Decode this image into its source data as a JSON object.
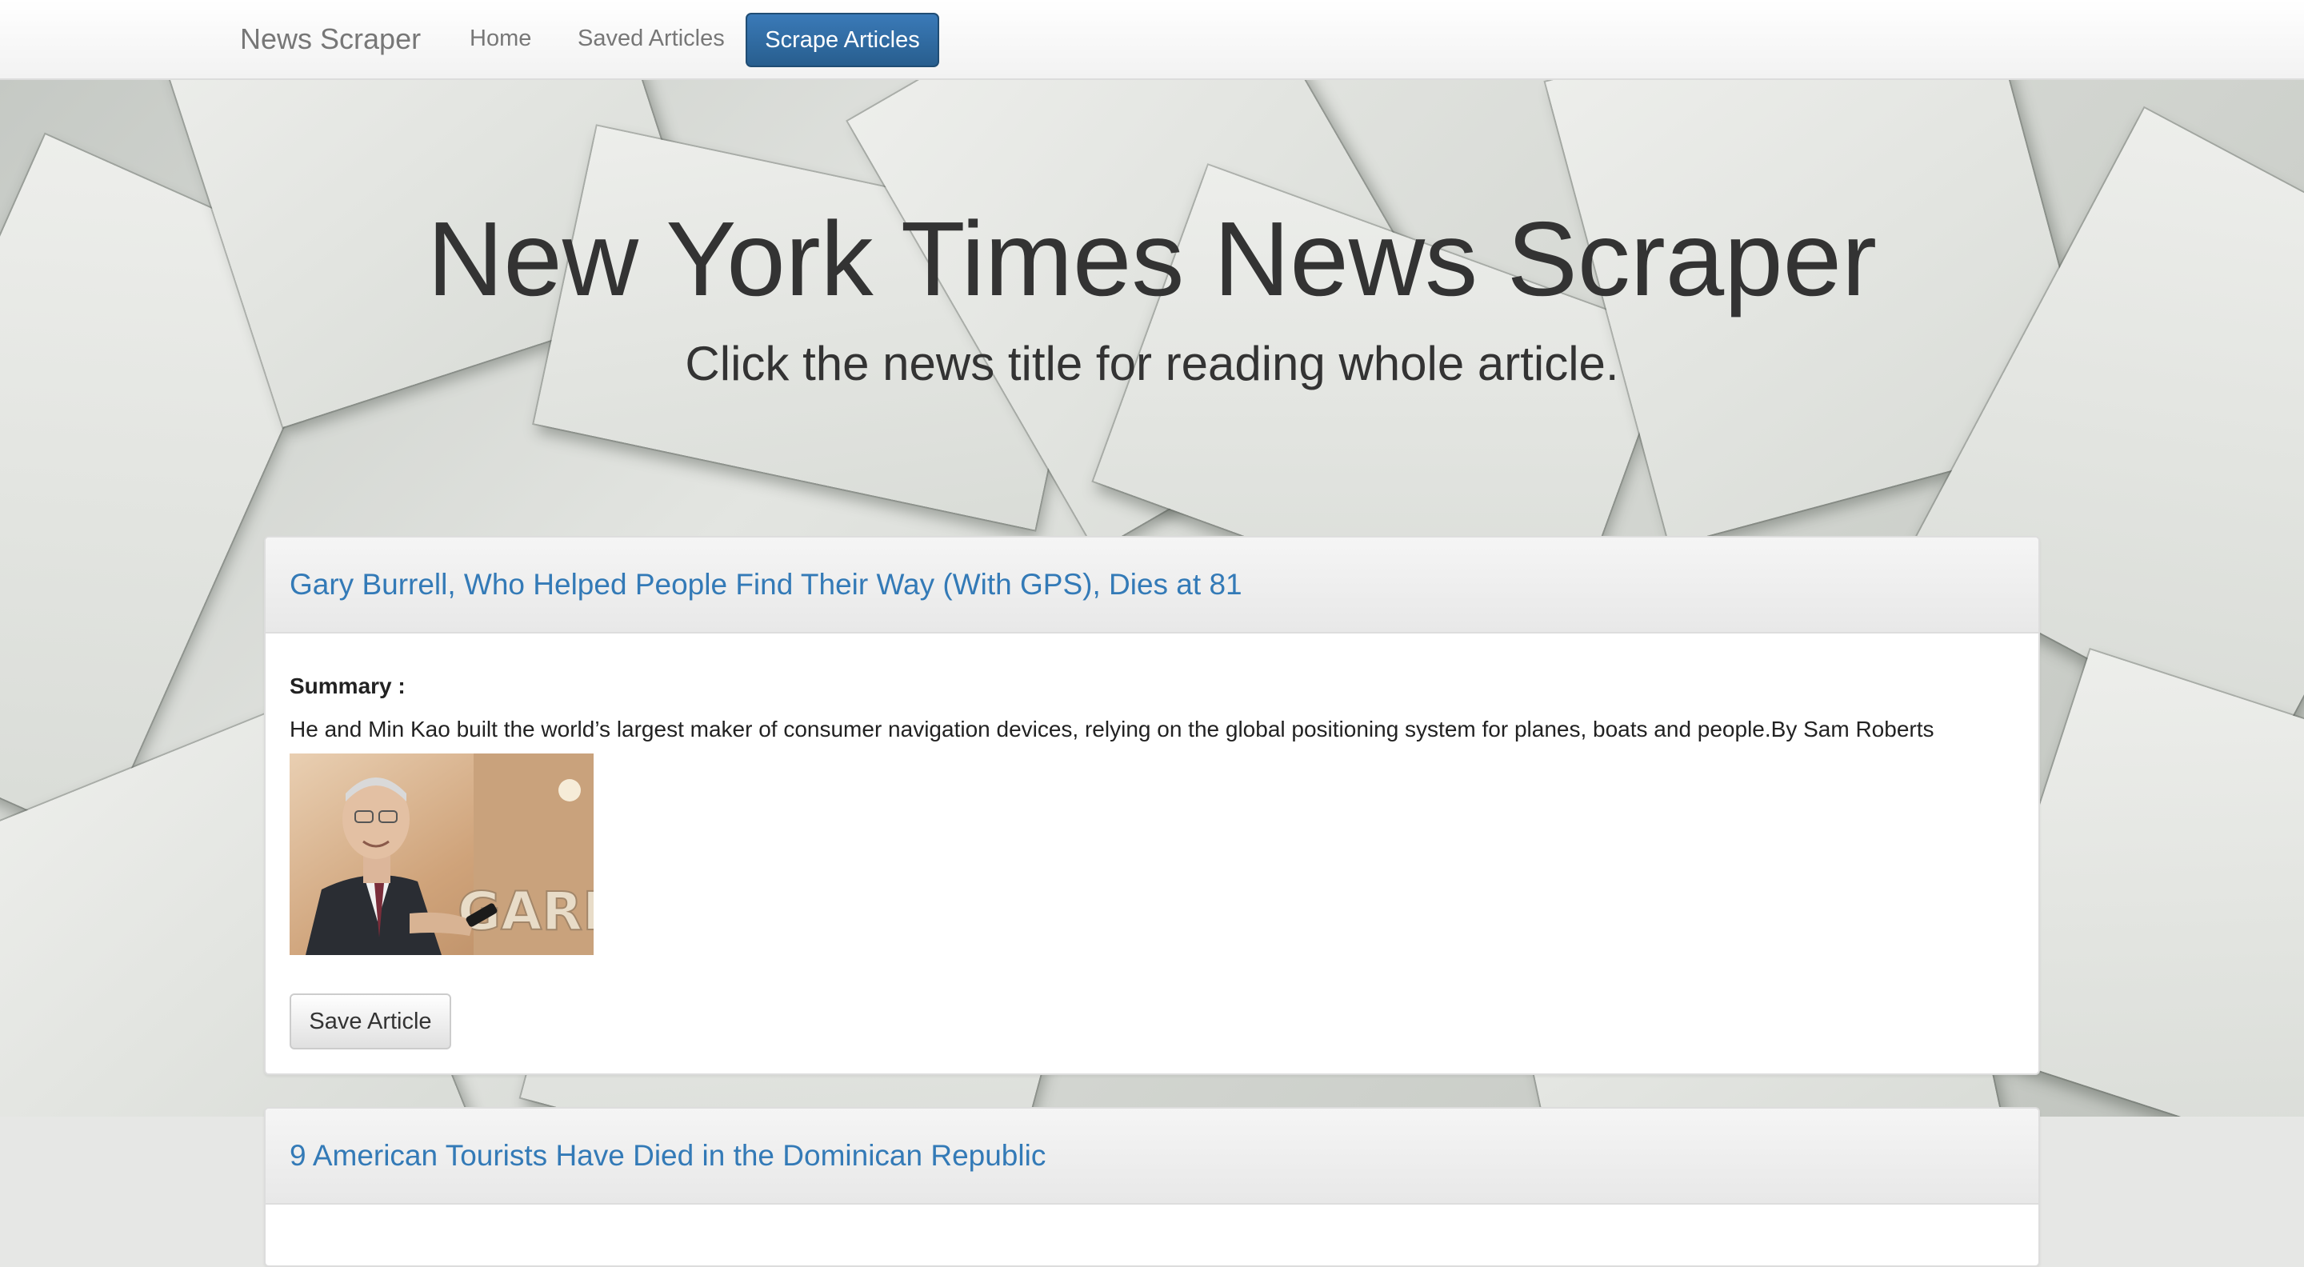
{
  "navbar": {
    "brand": "News Scraper",
    "items": [
      {
        "label": "Home"
      },
      {
        "label": "Saved Articles"
      },
      {
        "label": "Scrape Articles",
        "active": true
      }
    ],
    "active_color": "#337ab7"
  },
  "hero": {
    "title": "New York Times News Scraper",
    "subtitle": "Click the news title for reading whole article."
  },
  "articles": [
    {
      "title": "Gary Burrell, Who Helped People Find Their Way (With GPS), Dies at 81",
      "summary_label": "Summary :",
      "summary": "He and Min Kao built the world’s largest maker of consumer navigation devices, relying on the global positioning system for planes, boats and people.By Sam Roberts",
      "image_sign_text": "GARMIN",
      "save_label": "Save Article"
    },
    {
      "title": "9 American Tourists Have Died in the Dominican Republic"
    }
  ],
  "colors": {
    "link": "#337ab7",
    "button_primary": "#337ab7"
  }
}
